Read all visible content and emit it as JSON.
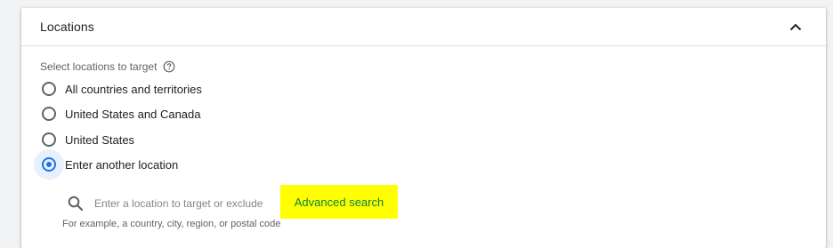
{
  "card": {
    "title": "Locations"
  },
  "section": {
    "label": "Select locations to target"
  },
  "options": [
    {
      "label": "All countries and territories",
      "checked": false
    },
    {
      "label": "United States and Canada",
      "checked": false
    },
    {
      "label": "United States",
      "checked": false
    },
    {
      "label": "Enter another location",
      "checked": true
    }
  ],
  "search": {
    "placeholder": "Enter a location to target or exclude",
    "value": "",
    "hint": "For example, a country, city, region, or postal code"
  },
  "advanced_search": {
    "label": "Advanced search",
    "highlight_color": "#ffff00",
    "text_color": "#0b8043"
  },
  "colors": {
    "accent": "#1a73e8",
    "focus_bg": "#e8f0fe"
  },
  "icons": {
    "collapse": "chevron-up-icon",
    "help": "help-outline-icon",
    "search": "search-icon"
  }
}
